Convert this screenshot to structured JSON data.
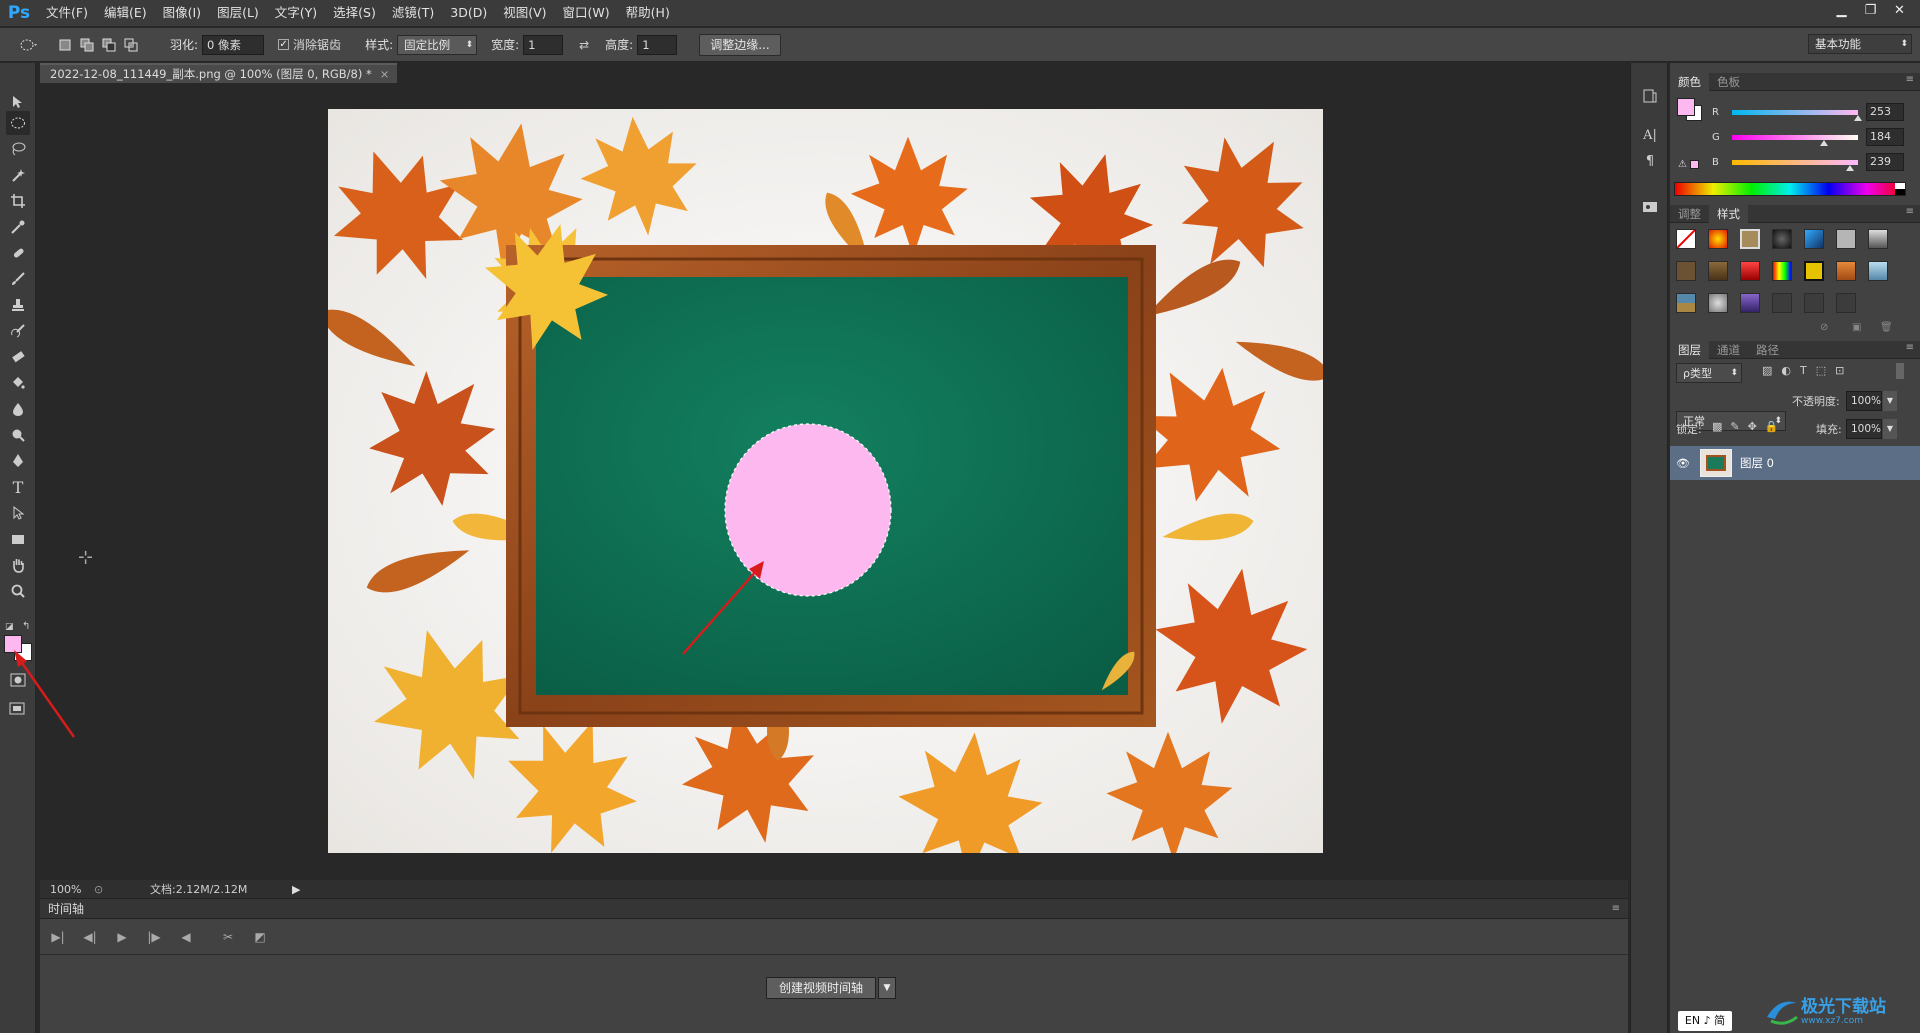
{
  "app": {
    "logo": "Ps"
  },
  "menu": [
    "文件(F)",
    "编辑(E)",
    "图像(I)",
    "图层(L)",
    "文字(Y)",
    "选择(S)",
    "滤镜(T)",
    "3D(D)",
    "视图(V)",
    "窗口(W)",
    "帮助(H)"
  ],
  "window_controls": {
    "minimize": "▁",
    "restore": "❐",
    "close": "✕"
  },
  "options": {
    "feather_label": "羽化:",
    "feather_value": "0 像素",
    "antialias_label": "消除锯齿",
    "style_label": "样式:",
    "style_value": "固定比例",
    "width_label": "宽度:",
    "width_value": "1",
    "height_label": "高度:",
    "height_value": "1",
    "refine_button": "调整边缘...",
    "workspace": "基本功能"
  },
  "document": {
    "tab_title": "2022-12-08_111449_副本.png @ 100% (图层 0, RGB/8) *",
    "close": "×"
  },
  "status": {
    "zoom": "100%",
    "doc_size": "文档:2.12M/2.12M"
  },
  "timeline": {
    "title": "时间轴",
    "create_button": "创建视频时间轴"
  },
  "color_panel": {
    "tabs": [
      "颜色",
      "色板"
    ],
    "r_label": "R",
    "g_label": "G",
    "b_label": "B",
    "r": 253,
    "g": 184,
    "b": 239,
    "foreground": "#fdb8ef",
    "background": "#ffffff"
  },
  "adjust_panel": {
    "tabs": [
      "调整",
      "样式"
    ]
  },
  "layers_panel": {
    "tabs": [
      "图层",
      "通道",
      "路径"
    ],
    "filter": "ρ类型",
    "blend_mode": "正常",
    "opacity_label": "不透明度:",
    "opacity": "100%",
    "lock_label": "锁定:",
    "fill_label": "填充:",
    "fill": "100%",
    "layer_name": "图层 0"
  },
  "ime": {
    "label": "EN ♪ 简"
  },
  "watermark": {
    "text": "极光下载站",
    "url": "www.xz7.com"
  },
  "colors": {
    "accent": "#31a8ff",
    "selection_fill": "#fcb8ef",
    "chalkboard": "#0f7a5c",
    "frame": "#9a4e1f",
    "arrow": "#d81b1b"
  }
}
